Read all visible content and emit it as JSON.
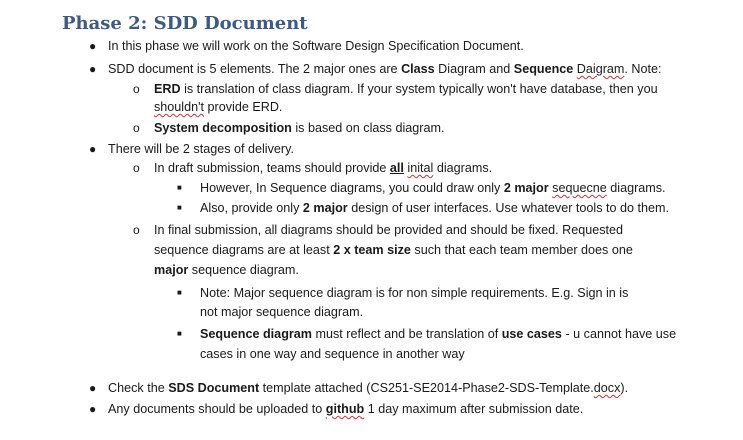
{
  "title": "Phase 2: SDD Document",
  "markers": {
    "bullet": "●",
    "circle": "o",
    "square": "■"
  },
  "items": {
    "b1": "In this phase we will work on the Software Design Specification Document.",
    "b2": {
      "pre": "SDD document is 5 elements. The 2 major ones are ",
      "class_bold": "Class",
      "mid1": " Diagram and ",
      "seq_bold": "Sequence",
      "sp": " ",
      "daigram": "Daigram",
      "post": ". Note:"
    },
    "b2a": {
      "erd": "ERD",
      "line1_rest": " is translation of class diagram. If your system typically won't have database, then you",
      "shouldnt": "shouldn't",
      "line2_rest": " provide ERD."
    },
    "b2b": {
      "bold": "System decomposition",
      "rest": " is based on class diagram."
    },
    "b3": "There will be 2 stages of delivery.",
    "b3a": {
      "pre": "In draft submission, teams should provide ",
      "all": "all",
      "sp": " ",
      "inital": "inital",
      "post": " diagrams."
    },
    "b3a1": {
      "pre": "However, In Sequence diagrams, you could draw only ",
      "bold": "2 major",
      "sp": " ",
      "sequecne": "sequecne",
      "post": " diagrams."
    },
    "b3a2": {
      "pre": "Also, provide only ",
      "bold": "2 major",
      "post": " design of user interfaces. Use whatever tools to do them."
    },
    "b3b": {
      "line1": "In final submission, all diagrams should be provided and should be fixed. Requested",
      "line2_pre": "sequence diagrams are at least ",
      "line2_bold": "2 x team size",
      "line2_post": " such that each team member does one",
      "line3_bold": "major",
      "line3_post": " sequence diagram."
    },
    "b3b1": {
      "line1": "Note: Major sequence diagram is for non simple requirements. E.g. Sign in is",
      "line2": "not major sequence diagram."
    },
    "b3b2": {
      "bold1": "Sequence diagram",
      "mid": " must reflect and be translation of ",
      "bold2": "use cases",
      "post": " - u cannot have use",
      "line2": "cases in one way and sequence in another way"
    },
    "b4": {
      "pre": "Check the ",
      "bold": "SDS Document",
      "mid": " template attached (CS251-SE2014-Phase2-SDS-Template.",
      "docx": "docx",
      "post": ")."
    },
    "b5": {
      "pre": "Any documents should be uploaded to ",
      "github": "github",
      "post": " 1 day maximum after submission date."
    }
  }
}
